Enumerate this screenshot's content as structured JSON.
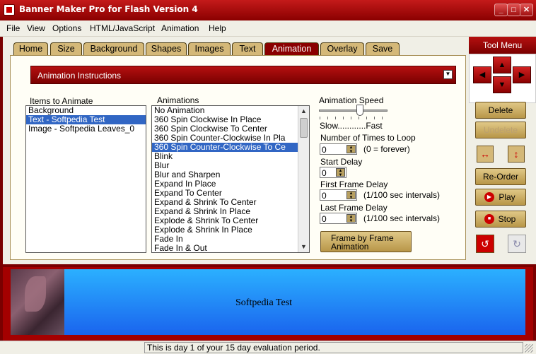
{
  "window": {
    "title": "Banner Maker Pro for Flash Version 4"
  },
  "menu": [
    "File",
    "View",
    "Options",
    "HTML/JavaScript",
    "Animation",
    "Help"
  ],
  "tabs": [
    "Home",
    "Size",
    "Background",
    "Shapes",
    "Images",
    "Text",
    "Animation",
    "Overlay",
    "Save"
  ],
  "active_tab": "Animation",
  "instructions_bar": {
    "label": "Animation Instructions"
  },
  "items_panel": {
    "label": "Items to Animate",
    "items": [
      "Background",
      "Text - Softpedia Test",
      "Image - Softpedia Leaves_0"
    ],
    "selected": "Text - Softpedia Test"
  },
  "animations_panel": {
    "label": "Animations",
    "items": [
      "No Animation",
      "360 Spin Clockwise In Place",
      "360 Spin Clockwise To Center",
      "360 Spin Counter-Clockwise In Pla",
      "360 Spin Counter-Clockwise To Ce",
      "Blink",
      "Blur",
      "Blur and Sharpen",
      "Expand In Place",
      "Expand To Center",
      "Expand & Shrink To Center",
      "Expand & Shrink In Place",
      "Explode & Shrink To Center",
      "Explode & Shrink In Place",
      "Fade In",
      "Fade In & Out"
    ],
    "selected": "360 Spin Counter-Clockwise To Ce"
  },
  "speed": {
    "label": "Animation Speed",
    "slow_fast": "Slow............Fast",
    "value_fraction": 0.6
  },
  "loop": {
    "label": "Number of Times to Loop",
    "value": "0",
    "note": "(0 = forever)"
  },
  "start_delay": {
    "label": "Start Delay",
    "value": "0"
  },
  "first_frame_delay": {
    "label": "First Frame Delay",
    "value": "0",
    "note": "(1/100 sec intervals)"
  },
  "last_frame_delay": {
    "label": "Last Frame Delay",
    "value": "0",
    "note": "(1/100 sec intervals)"
  },
  "frame_button": {
    "line1": "Frame by Frame",
    "line2": "Animation"
  },
  "tool_menu": {
    "title": "Tool Menu",
    "delete": "Delete",
    "undelete": "Undelete",
    "reorder": "Re-Order",
    "play": "Play",
    "stop": "Stop"
  },
  "banner": {
    "text": "Softpedia Test"
  },
  "status": {
    "message": "This is day 1 of your 15 day evaluation period."
  },
  "colors": {
    "accent": "#8a0000",
    "gold": "#d4b878",
    "selection": "#3166c4"
  }
}
